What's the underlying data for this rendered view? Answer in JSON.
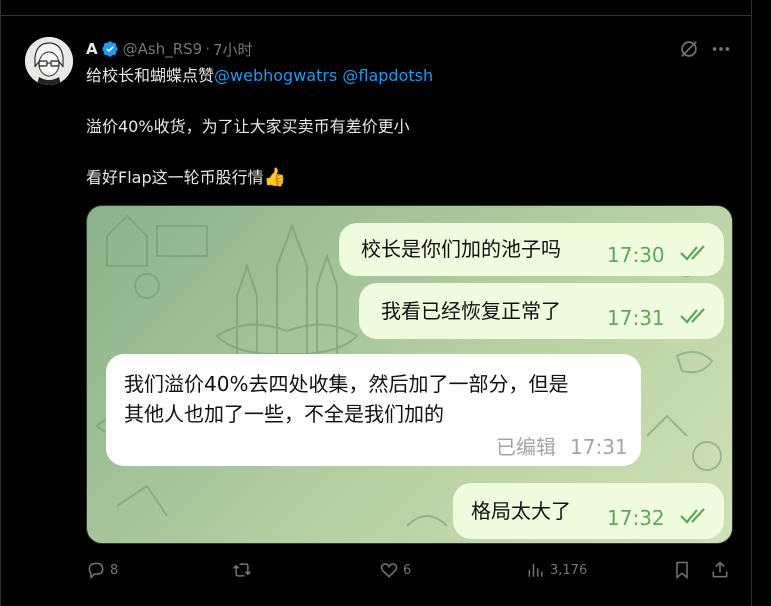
{
  "post": {
    "author_name": "A",
    "handle": "@Ash_RS9",
    "separator": "·",
    "time": "7小时",
    "line1_prefix": "给校长和蝴蝶点赞",
    "mention1": "@webhogwatrs",
    "mention2": "@flapdotsh",
    "line2": "溢价40%收货，为了让大家买卖币有差价更小",
    "line3": "看好Flap这一轮币股行情",
    "thumbs_emoji": "👍"
  },
  "chat": {
    "messages": [
      {
        "text": "校长是你们加的池子吗",
        "time": "17:30",
        "type": "out"
      },
      {
        "text": "我看已经恢复正常了",
        "time": "17:31",
        "type": "out"
      },
      {
        "line1": "我们溢价40%去四处收集，然后加了一部分，但是",
        "line2": "其他人也加了一些，不全是我们加的",
        "edited": "已编辑",
        "time": "17:31",
        "type": "in"
      },
      {
        "text": "格局太大了",
        "time": "17:32",
        "type": "out"
      }
    ]
  },
  "actions": {
    "replies": "8",
    "reposts": "",
    "likes": "6",
    "views": "3,176"
  },
  "colors": {
    "background": "#000000",
    "text": "#e7e9ea",
    "muted": "#71767b",
    "link": "#1d9bf0",
    "verified": "#1d9bf0",
    "bubble_out": "#effdde",
    "bubble_in": "#ffffff",
    "time_green": "#5fa65a"
  },
  "icons": [
    "verified-badge-icon",
    "grok-icon",
    "more-icon",
    "reply-icon",
    "repost-icon",
    "like-icon",
    "views-icon",
    "bookmark-icon",
    "share-icon",
    "read-ticks-icon"
  ]
}
